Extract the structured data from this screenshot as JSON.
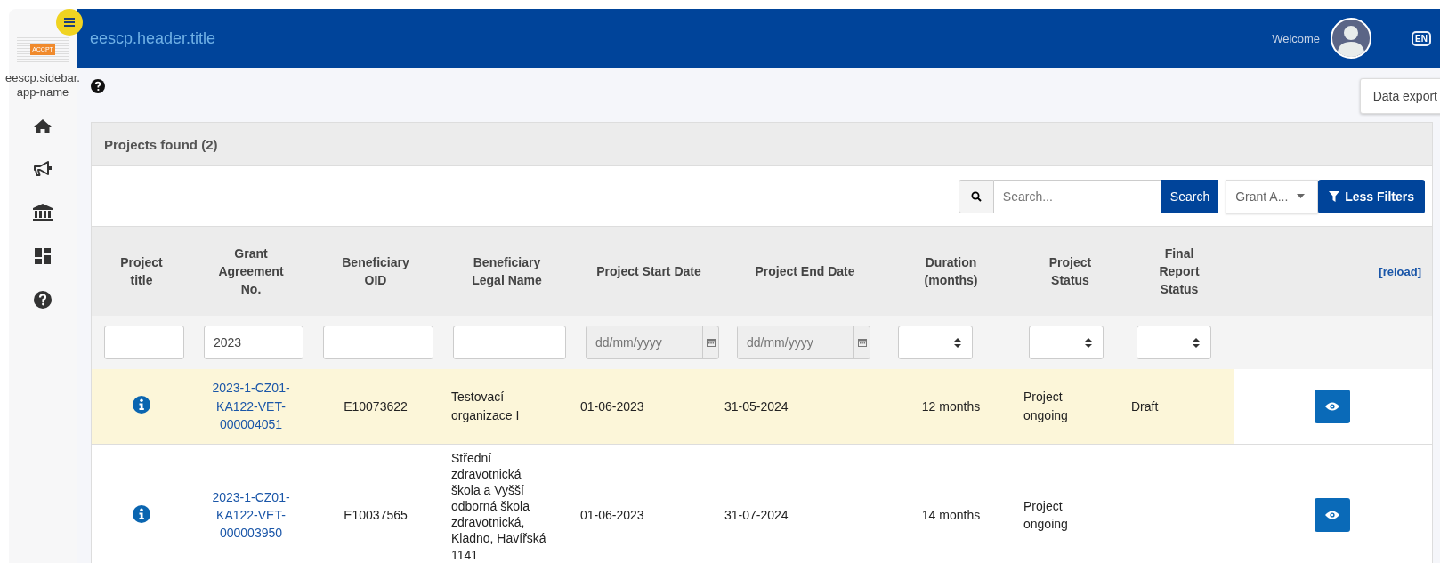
{
  "header": {
    "title": "eescp.header.title",
    "welcome": "Welcome",
    "language": "EN"
  },
  "sidebar": {
    "app_name": "eescp.sidebar.app-name",
    "logo_text": "ACCPT",
    "items": [
      {
        "kind": "nav"
      },
      {
        "kind": "nav"
      },
      {
        "kind": "nav"
      },
      {
        "kind": "nav"
      },
      {
        "kind": "nav"
      }
    ]
  },
  "data_export": "Data export",
  "card": {
    "title": "Projects found (2)",
    "search": {
      "placeholder": "Search...",
      "button": "Search"
    },
    "select": {
      "value": "Grant A..."
    },
    "filters_button": "Less Filters",
    "reload": "[reload]",
    "columns": [
      "Project title",
      "Grant Agreement No.",
      "Beneficiary OID",
      "Beneficiary Legal Name",
      "Project Start Date",
      "Project End Date",
      "Duration (months)",
      "Project Status",
      "Final Report Status"
    ],
    "filters": [
      {
        "kind": "text"
      },
      {
        "kind": "text",
        "value": "2023"
      },
      {
        "kind": "text"
      },
      {
        "kind": "text"
      },
      {
        "kind": "date",
        "placeholder": "dd/mm/yyyy"
      },
      {
        "kind": "date",
        "placeholder": "dd/mm/yyyy"
      },
      {
        "kind": "select"
      },
      {
        "kind": "select"
      },
      {
        "kind": "select"
      }
    ],
    "rows": [
      {
        "selected": true,
        "grant": "2023-1-CZ01-KA122-VET-000004051",
        "oid": "E10073622",
        "legal_name": "Testovací organizace I",
        "start": "01-06-2023",
        "end": "31-05-2024",
        "duration": "12 months",
        "status": "Project ongoing",
        "final_report": "Draft"
      },
      {
        "selected": false,
        "grant": "2023-1-CZ01-KA122-VET-000003950",
        "oid": "E10037565",
        "legal_name": "Střední zdravotnická škola a Vyšší odborná škola zdravotnická, Kladno, Havířská 1141",
        "start": "01-06-2023",
        "end": "31-07-2024",
        "duration": "14 months",
        "status": "Project ongoing"
      }
    ]
  }
}
